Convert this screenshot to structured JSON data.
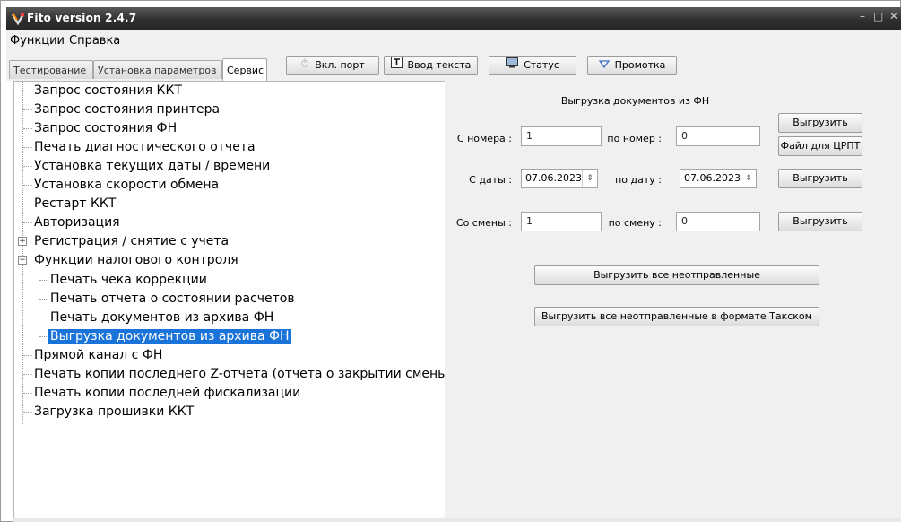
{
  "window": {
    "title": "Fito version 2.4.7",
    "minimize": "–",
    "maximize": "□",
    "close": "✕"
  },
  "menu": {
    "items": [
      {
        "label": "Функции"
      },
      {
        "label": "Справка"
      }
    ]
  },
  "tabs": [
    {
      "label": "Тестирование",
      "active": false
    },
    {
      "label": "Установка параметров",
      "active": false
    },
    {
      "label": "Сервис",
      "active": true
    }
  ],
  "toolbar": {
    "port": {
      "label": "Вкл. порт",
      "icon": "power-icon"
    },
    "text": {
      "label": "Ввод текста",
      "icon": "text-input-icon"
    },
    "status": {
      "label": "Статус",
      "icon": "monitor-icon"
    },
    "feed": {
      "label": "Промотка",
      "icon": "triangle-down-icon"
    }
  },
  "tree": {
    "items": [
      {
        "label": "Запрос состояния ККТ"
      },
      {
        "label": "Запрос состояния принтера"
      },
      {
        "label": "Запрос состояния ФН"
      },
      {
        "label": "Печать диагностического отчета"
      },
      {
        "label": "Установка текущих даты / времени"
      },
      {
        "label": "Установка скорости обмена"
      },
      {
        "label": "Рестарт ККТ"
      },
      {
        "label": "Авторизация"
      },
      {
        "label": "Регистрация / снятие с учета",
        "expander": "+"
      },
      {
        "label": "Функции налогового контроля",
        "expander": "−"
      },
      {
        "label": "Печать чека коррекции"
      },
      {
        "label": "Печать отчета о состоянии расчетов"
      },
      {
        "label": "Печать документов из архива ФН"
      },
      {
        "label": "Выгрузка документов из архива ФН",
        "selected": true
      },
      {
        "label": "Прямой канал с ФН"
      },
      {
        "label": "Печать копии последнего Z-отчета (отчета о закрытии смены)"
      },
      {
        "label": "Печать копии последней фискализации"
      },
      {
        "label": "Загрузка прошивки ККТ"
      }
    ]
  },
  "panel": {
    "title": "Выгрузка документов из ФН",
    "by_number": {
      "from_label": "С номера :",
      "from_value": "1",
      "to_label": "по номер :",
      "to_value": "0",
      "export_button": "Выгрузить",
      "crpt_button": "Файл для ЦРПТ"
    },
    "by_date": {
      "from_label": "С даты :",
      "from_value": "07.06.2023",
      "to_label": "по дату :",
      "to_value": "07.06.2023",
      "export_button": "Выгрузить",
      "spin_glyph": "⇕"
    },
    "by_shift": {
      "from_label": "Со смены :",
      "from_value": "1",
      "to_label": "по смену :",
      "to_value": "0",
      "export_button": "Выгрузить"
    },
    "export_all_button": "Выгрузить все неотправленные",
    "export_taxcom_button": "Выгрузить все неотправленные в формате Такском"
  },
  "colors": {
    "selection": "#1a73d9",
    "titlebar": "#2f2f2f",
    "panel_bg": "#f0f0f0"
  }
}
